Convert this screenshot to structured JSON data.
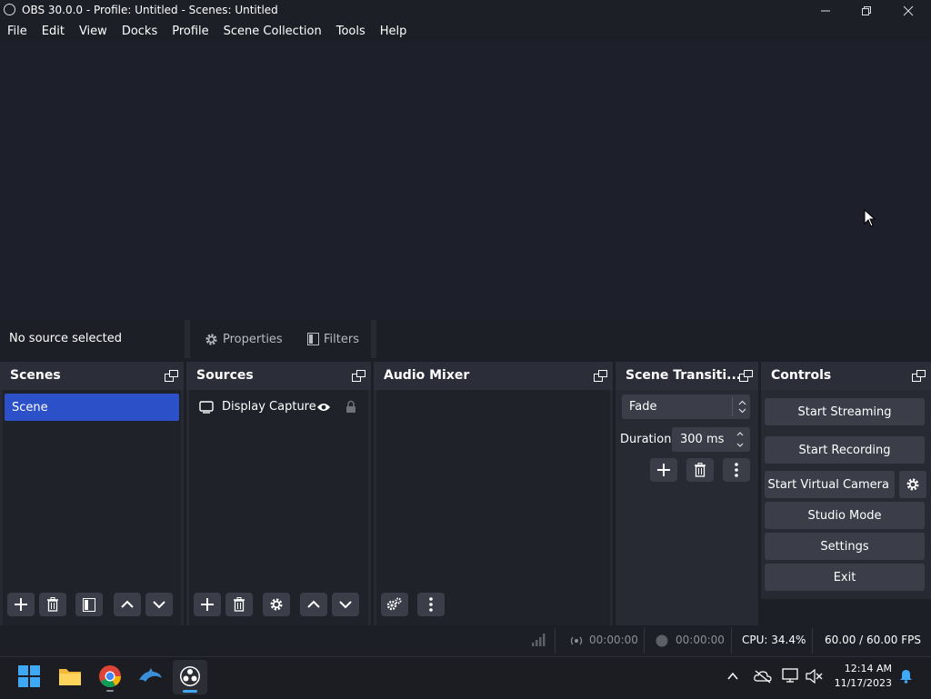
{
  "window": {
    "title": "OBS 30.0.0 - Profile: Untitled - Scenes: Untitled",
    "minimize_icon": "minimize-icon",
    "maximize_icon": "maximize-icon",
    "close_icon": "close-icon"
  },
  "menu": [
    "File",
    "Edit",
    "View",
    "Docks",
    "Profile",
    "Scene Collection",
    "Tools",
    "Help"
  ],
  "context_bar": {
    "status": "No source selected",
    "properties_label": "Properties",
    "filters_label": "Filters"
  },
  "docks": {
    "scenes": {
      "title": "Scenes",
      "items": [
        "Scene"
      ]
    },
    "sources": {
      "title": "Sources",
      "items": [
        "Display Capture"
      ]
    },
    "audio_mixer": {
      "title": "Audio Mixer"
    },
    "transitions": {
      "title": "Scene Transiti...",
      "selected": "Fade",
      "duration_label": "Duration",
      "duration_value": "300 ms"
    },
    "controls": {
      "title": "Controls",
      "start_streaming": "Start Streaming",
      "start_recording": "Start Recording",
      "start_virtual_camera": "Start Virtual Camera",
      "studio_mode": "Studio Mode",
      "settings": "Settings",
      "exit": "Exit"
    }
  },
  "status_bar": {
    "stream_time": "00:00:00",
    "record_time": "00:00:00",
    "cpu": "CPU: 34.4%",
    "fps": "60.00 / 60.00 FPS"
  },
  "taskbar": {
    "time": "12:14 AM",
    "date": "11/17/2023",
    "apps": [
      "windows-start-icon",
      "file-explorer-icon",
      "chrome-icon",
      "dolphin-icon",
      "obs-icon"
    ]
  },
  "colors": {
    "selection": "#2b50c8",
    "panel": "#272a33",
    "background": "#1d1f26"
  }
}
